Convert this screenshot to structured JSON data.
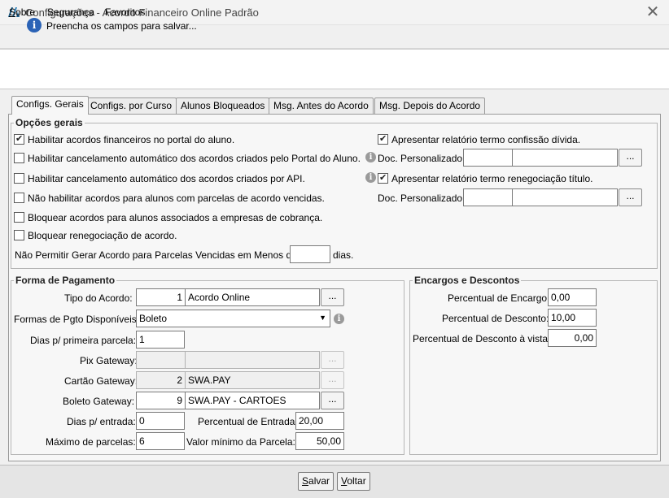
{
  "window": {
    "title": "Configurações - Acordo Financeiro Online Padrão"
  },
  "menu": {
    "items": [
      {
        "pre": "",
        "u": "S",
        "post": "obre"
      },
      {
        "pre": "",
        "u": "",
        "post": "Segurança"
      },
      {
        "pre": "",
        "u": "",
        "post": "Favoritos"
      }
    ]
  },
  "info": {
    "message": "Preencha os campos para salvar..."
  },
  "tabs": [
    "Configs. Gerais",
    "Configs. por Curso",
    "Alunos Bloqueados",
    "Msg. Antes do Acordo",
    "Msg. Depois do Acordo"
  ],
  "opcoes": {
    "title": "Opções gerais",
    "left": [
      {
        "label": "Habilitar acordos financeiros no portal do aluno.",
        "checked": true
      },
      {
        "label": "Habilitar cancelamento automático dos acordos criados pelo Portal do Aluno.",
        "checked": false
      },
      {
        "label": "Habilitar cancelamento automático dos acordos criados por API.",
        "checked": false
      },
      {
        "label": "Não habilitar acordos para alunos com parcelas de acordo vencidas.",
        "checked": false
      },
      {
        "label": "Bloquear acordos para alunos associados a empresas de cobrança.",
        "checked": false
      },
      {
        "label": "Bloquear renegociação de acordo.",
        "checked": false
      }
    ],
    "dias_label": "Não Permitir Gerar Acordo para Parcelas Vencidas em Menos de",
    "dias_value": "",
    "dias_suffix": "dias.",
    "confissao": {
      "label": "Apresentar relatório termo confissão dívida.",
      "checked": true
    },
    "reneg": {
      "label": "Apresentar relatório termo renegociação título.",
      "checked": true
    },
    "doc_label": "Doc. Personalizado:",
    "doc1_code": "",
    "doc1_desc": "",
    "doc2_code": "",
    "doc2_desc": "",
    "ellipsis": "..."
  },
  "pagamento": {
    "title": "Forma de Pagamento",
    "tipo_label": "Tipo do Acordo:",
    "tipo_code": "1",
    "tipo_desc": "Acordo Online",
    "formas_label": "Formas de Pgto Disponíveis:",
    "formas_value": "Boleto",
    "dias_primeira_label": "Dias p/ primeira parcela:",
    "dias_primeira_value": "1",
    "pix_label": "Pix Gateway:",
    "pix_code": "",
    "pix_desc": "",
    "cartao_label": "Cartão Gateway:",
    "cartao_code": "2",
    "cartao_desc": "SWA.PAY",
    "boleto_label": "Boleto Gateway:",
    "boleto_code": "9",
    "boleto_desc": "SWA.PAY - CARTOES",
    "dias_entrada_label": "Dias p/ entrada:",
    "dias_entrada_value": "0",
    "perc_entrada_label": "Percentual de Entrada:",
    "perc_entrada_value": "20,00",
    "max_parcelas_label": "Máximo de parcelas:",
    "max_parcelas_value": "6",
    "valor_min_label": "Valor mínimo da Parcela:",
    "valor_min_value": "50,00"
  },
  "encargos": {
    "title": "Encargos e Descontos",
    "encargo_label": "Percentual de Encargo:",
    "encargo_value": "0,00",
    "desconto_label": "Percentual de Desconto:",
    "desconto_value": "10,00",
    "desconto_vista_label": "Percentual de Desconto à vista:",
    "desconto_vista_value": "0,00"
  },
  "footer": {
    "salvar_u": "S",
    "salvar_rest": "alvar",
    "voltar_u": "V",
    "voltar_rest": "oltar"
  }
}
